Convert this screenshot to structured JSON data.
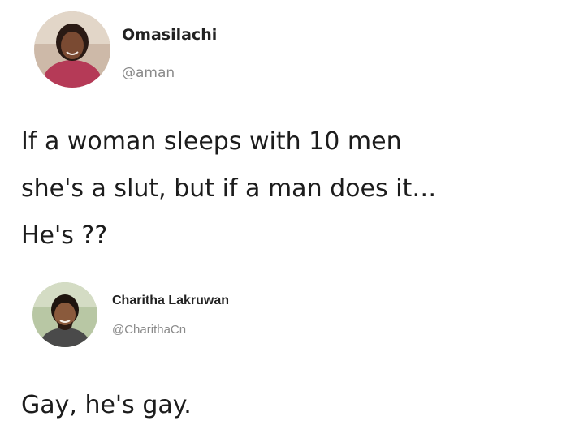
{
  "posts": [
    {
      "author": {
        "display_name": "Omasilachi",
        "handle": "@aman",
        "avatar": "profile-photo-woman"
      },
      "text_lines": [
        "If a woman sleeps with 10 men",
        "she's a slut, but if a man does it…",
        "He's ??"
      ]
    },
    {
      "author": {
        "display_name": "Charitha Lakruwan",
        "handle": "@CharithaCn",
        "avatar": "profile-photo-man"
      },
      "text_lines": [
        "Gay, he's gay."
      ]
    }
  ]
}
